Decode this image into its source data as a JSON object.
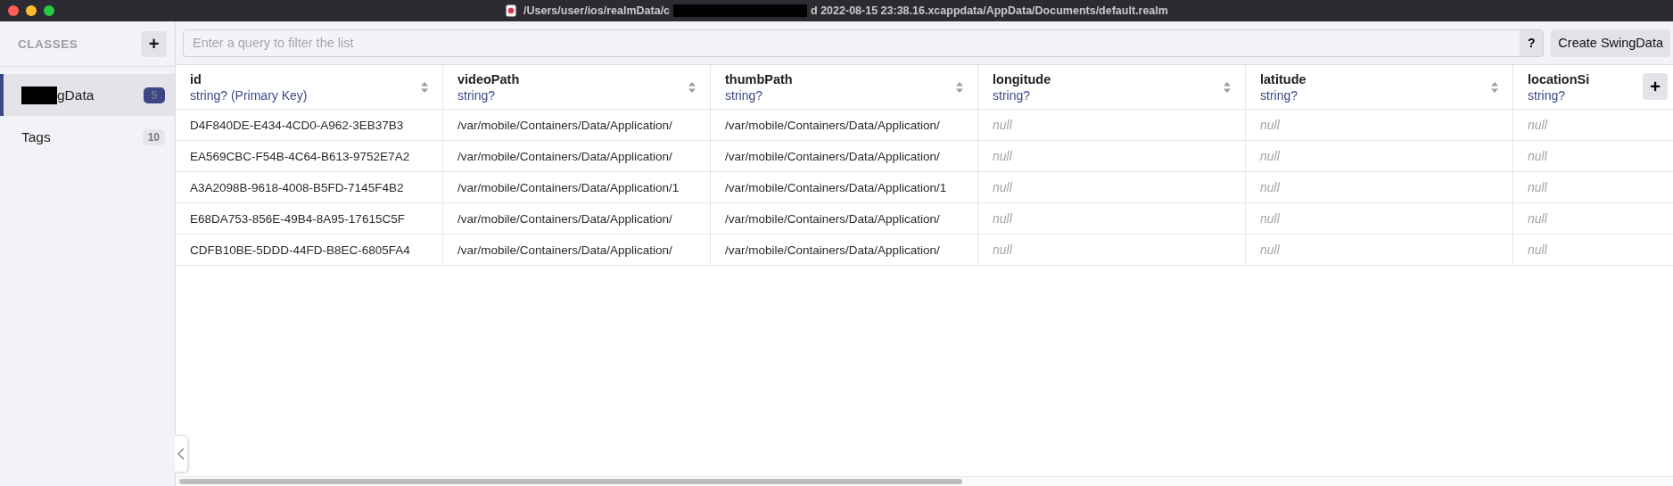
{
  "window": {
    "title_start": "/Users/user/ios/realmData/c",
    "title_end": "d 2022-08-15 23:38.16.xcappdata/AppData/Documents/default.realm"
  },
  "sidebar": {
    "heading": "CLASSES",
    "add_label": "+",
    "items": [
      {
        "label": "gData",
        "redacted": true,
        "count": "5",
        "selected": true
      },
      {
        "label": "Tags",
        "redacted": false,
        "count": "10",
        "selected": false
      }
    ]
  },
  "toolbar": {
    "search": {
      "placeholder": "Enter a query to filter the list"
    },
    "help_label": "?",
    "create_label": "Create SwingData"
  },
  "table": {
    "add_column_label": "+",
    "columns": [
      {
        "name": "id",
        "type": "string? (Primary Key)"
      },
      {
        "name": "videoPath",
        "type": "string?"
      },
      {
        "name": "thumbPath",
        "type": "string?"
      },
      {
        "name": "longitude",
        "type": "string?"
      },
      {
        "name": "latitude",
        "type": "string?"
      },
      {
        "name": "locationSi",
        "type": "string?"
      }
    ],
    "rows": [
      {
        "cells": [
          {
            "kind": "value",
            "text": "D4F840DE-E434-4CD0-A962-3EB37B3"
          },
          {
            "kind": "value",
            "text": "/var/mobile/Containers/Data/Application/"
          },
          {
            "kind": "value",
            "text": "/var/mobile/Containers/Data/Application/"
          },
          {
            "kind": "null",
            "text": "null"
          },
          {
            "kind": "null",
            "text": "null"
          },
          {
            "kind": "null",
            "text": "null"
          }
        ]
      },
      {
        "cells": [
          {
            "kind": "value",
            "text": "EA569CBC-F54B-4C64-B613-9752E7A2"
          },
          {
            "kind": "value",
            "text": "/var/mobile/Containers/Data/Application/"
          },
          {
            "kind": "value",
            "text": "/var/mobile/Containers/Data/Application/"
          },
          {
            "kind": "null",
            "text": "null"
          },
          {
            "kind": "null",
            "text": "null"
          },
          {
            "kind": "null",
            "text": "null"
          }
        ]
      },
      {
        "cells": [
          {
            "kind": "value",
            "text": "A3A2098B-9618-4008-B5FD-7145F4B2"
          },
          {
            "kind": "value",
            "text": "/var/mobile/Containers/Data/Application/1"
          },
          {
            "kind": "value",
            "text": "/var/mobile/Containers/Data/Application/1"
          },
          {
            "kind": "null",
            "text": "null"
          },
          {
            "kind": "null",
            "text": "null"
          },
          {
            "kind": "null",
            "text": "null"
          }
        ]
      },
      {
        "cells": [
          {
            "kind": "value",
            "text": "E68DA753-856E-49B4-8A95-17615C5F"
          },
          {
            "kind": "value",
            "text": "/var/mobile/Containers/Data/Application/"
          },
          {
            "kind": "value",
            "text": "/var/mobile/Containers/Data/Application/"
          },
          {
            "kind": "null",
            "text": "null"
          },
          {
            "kind": "null",
            "text": "null"
          },
          {
            "kind": "null",
            "text": "null"
          }
        ]
      },
      {
        "cells": [
          {
            "kind": "value",
            "text": "CDFB10BE-5DDD-44FD-B8EC-6805FA4"
          },
          {
            "kind": "value",
            "text": "/var/mobile/Containers/Data/Application/"
          },
          {
            "kind": "value",
            "text": "/var/mobile/Containers/Data/Application/"
          },
          {
            "kind": "null",
            "text": "null"
          },
          {
            "kind": "null",
            "text": "null"
          },
          {
            "kind": "null",
            "text": "null"
          }
        ]
      }
    ]
  }
}
